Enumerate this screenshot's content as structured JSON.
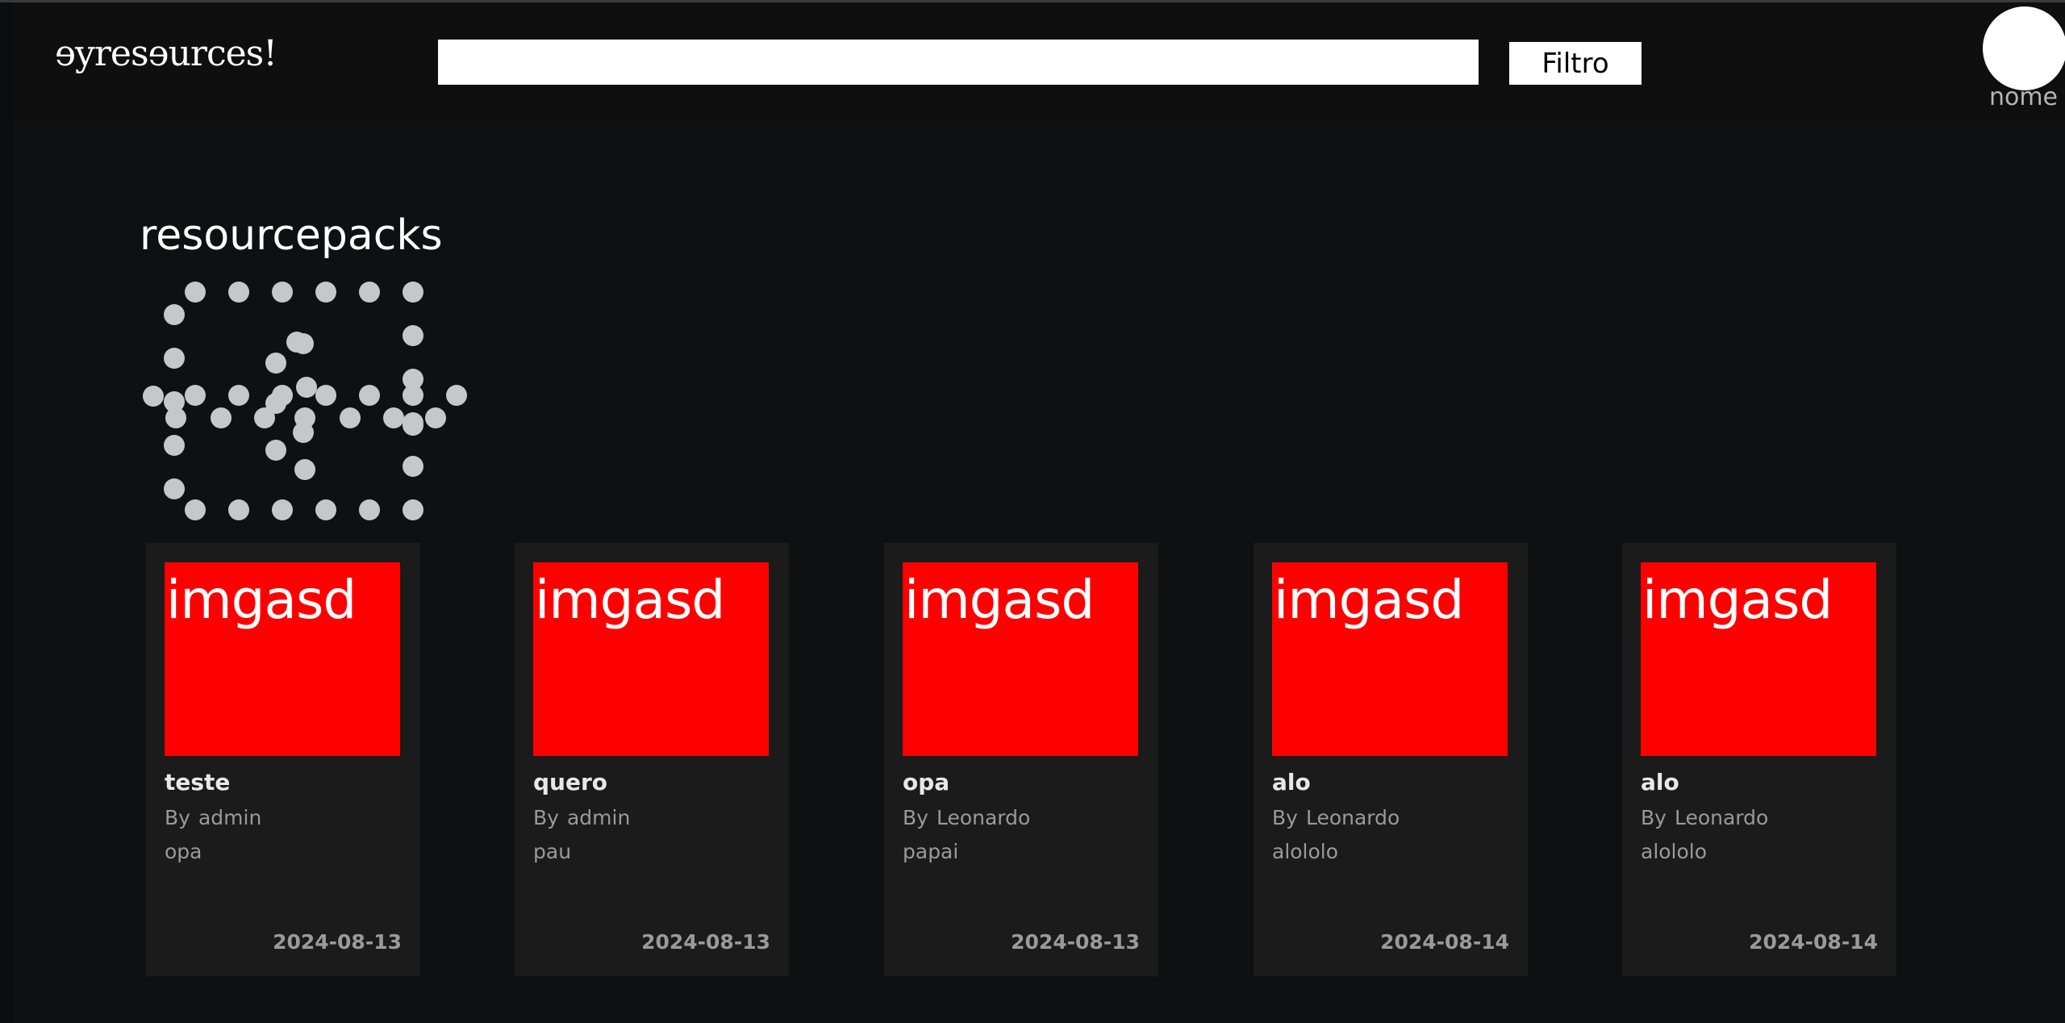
{
  "header": {
    "logo_text": "ɘyresɘurces!",
    "search": {
      "value": "",
      "placeholder": ""
    },
    "filter_label": "Filtro",
    "user_name": "nome"
  },
  "main": {
    "section_title": "resourcepacks",
    "cards": [
      {
        "image_text": "imgasd",
        "title": "teste",
        "by_label": "By",
        "author": "admin",
        "description": "opa",
        "date": "2024-08-13"
      },
      {
        "image_text": "imgasd",
        "title": "quero",
        "by_label": "By",
        "author": "admin",
        "description": "pau",
        "date": "2024-08-13"
      },
      {
        "image_text": "imgasd",
        "title": "opa",
        "by_label": "By",
        "author": "Leonardo",
        "description": "papai",
        "date": "2024-08-13"
      },
      {
        "image_text": "imgasd",
        "title": "alo",
        "by_label": "By",
        "author": "Leonardo",
        "description": "alololo",
        "date": "2024-08-14"
      },
      {
        "image_text": "imgasd",
        "title": "alo",
        "by_label": "By",
        "author": "Leonardo",
        "description": "alololo",
        "date": "2024-08-14"
      }
    ]
  },
  "colors": {
    "background": "#0d1112",
    "header": "#0f0f0f",
    "card": "#1b1b1b",
    "thumbnail": "#ff0000",
    "dots": "#c4c8c9"
  }
}
